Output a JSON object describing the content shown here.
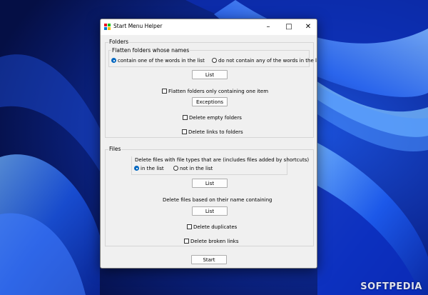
{
  "window": {
    "title": "Start Menu Helper",
    "minimize_icon": "minimize-icon",
    "maximize_icon": "maximize-icon",
    "close_icon": "close-icon"
  },
  "folders": {
    "legend": "Folders",
    "flatten_legend": "Flatten folders whose names",
    "option_contain": "contain one of the words in the list",
    "option_not_contain": "do not contain any of the words in the list",
    "selected_option": "contain",
    "list_button": "List",
    "flatten_single": "Flatten folders only containing one item",
    "exceptions_button": "Exceptions",
    "delete_empty": "Delete empty folders",
    "delete_links": "Delete links to folders"
  },
  "files": {
    "legend": "Files",
    "types_legend": "Delete files with file types that are (includes files added by shortcuts)",
    "option_in_list": "in the list",
    "option_not_in_list": "not in the list",
    "selected_option": "in_list",
    "list_button": "List",
    "name_label": "Delete files based on their name containing",
    "name_list_button": "List",
    "delete_duplicates": "Delete duplicates",
    "delete_broken": "Delete broken links"
  },
  "start_button": "Start",
  "watermark": "SOFTPEDIA",
  "colors": {
    "wallpaper_dark": "#0a1d6e",
    "wallpaper_bright": "#2f7cff",
    "radio_accent": "#0067c0"
  }
}
